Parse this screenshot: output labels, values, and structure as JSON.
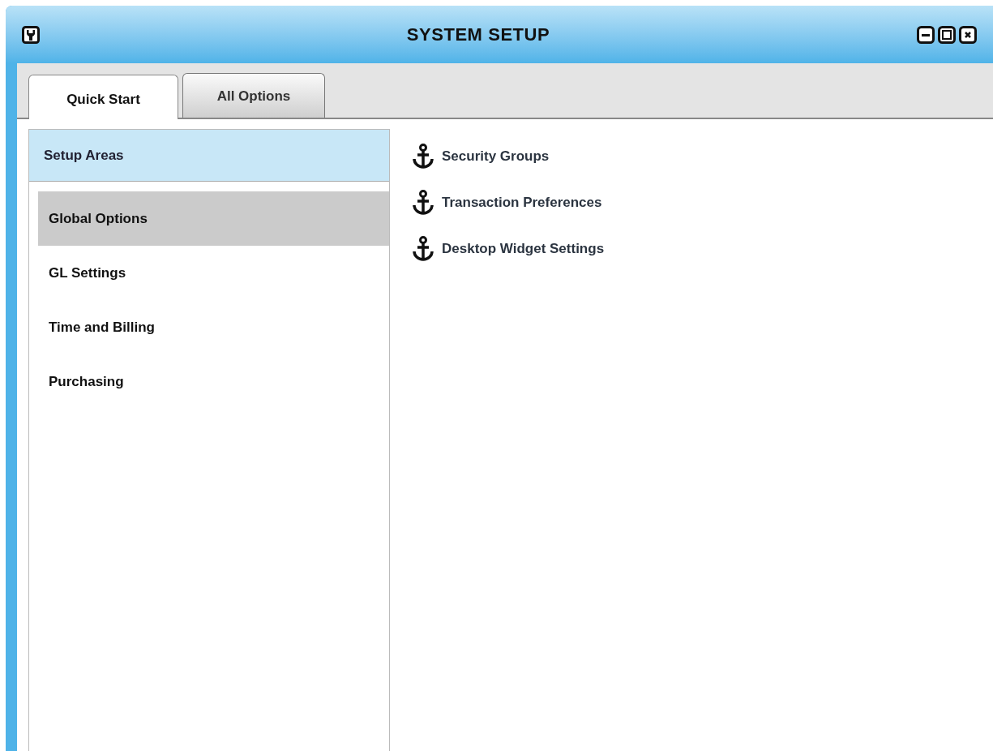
{
  "window": {
    "title": "SYSTEM SETUP"
  },
  "tabs": [
    {
      "label": "Quick Start",
      "selected": true
    },
    {
      "label": "All Options",
      "selected": false
    }
  ],
  "sidebar": {
    "header": "Setup Areas",
    "items": [
      {
        "label": "Global Options",
        "selected": true
      },
      {
        "label": "GL Settings",
        "selected": false
      },
      {
        "label": "Time and Billing",
        "selected": false
      },
      {
        "label": "Purchasing",
        "selected": false
      }
    ]
  },
  "links": [
    {
      "label": "Security Groups"
    },
    {
      "label": "Transaction Preferences"
    },
    {
      "label": "Desktop Widget Settings"
    }
  ]
}
